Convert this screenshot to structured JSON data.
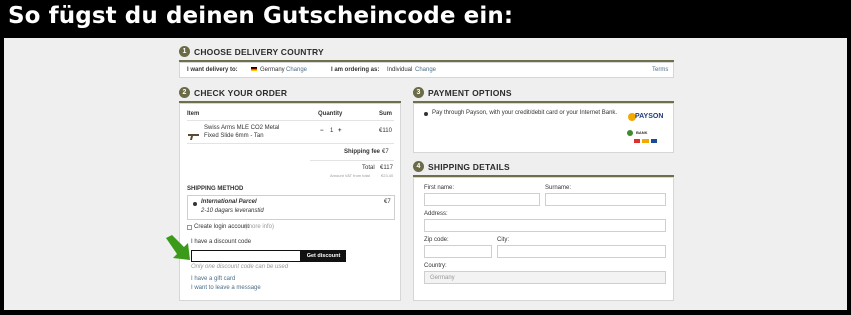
{
  "banner": {
    "title": "So fügst du deinen Gutscheincode ein:"
  },
  "sections": {
    "delivery": {
      "num": "1",
      "title": "CHOOSE DELIVERY COUNTRY"
    },
    "order": {
      "num": "2",
      "title": "CHECK YOUR ORDER"
    },
    "payment": {
      "num": "3",
      "title": "PAYMENT OPTIONS"
    },
    "shipping_details": {
      "num": "4",
      "title": "SHIPPING DETAILS"
    }
  },
  "delivery": {
    "deliver_label": "I want delivery to:",
    "country": "Germany",
    "change_label": "Change",
    "ordering_label": "I am ordering as:",
    "ordering_value": "Individual",
    "change2_label": "Change",
    "terms_label": "Terms"
  },
  "order": {
    "col_item": "Item",
    "col_qty": "Quantity",
    "col_sum": "Sum",
    "item": {
      "name_line1": "Swiss Arms MLE CO2 Metal",
      "name_line2": "Fixed Slide 6mm - Tan",
      "qty": "1",
      "minus": "−",
      "plus": "+",
      "sum": "€110"
    },
    "shipping_fee_label": "Shipping fee",
    "shipping_fee_value": "€7",
    "total_label": "Total",
    "total_value": "€117",
    "vat_note_label": "Amount VAT from total",
    "vat_note_value": "€23.40",
    "shipping_method_title": "SHIPPING METHOD",
    "method_name": "International Parcel",
    "method_days": "2-10 dagars leveranstid",
    "method_price": "€7",
    "create_account_label": "Create login account",
    "more_info_label": "(more info)",
    "discount_label": "I have a discount code",
    "get_discount_label": "Get discount",
    "discount_hint": "Only one discount code can be used",
    "gift_card_label": "I have a gift card",
    "message_label": "I want to leave a message"
  },
  "payment": {
    "option_text": "Pay through Payson, with your credit/debit card or your Internet Bank.",
    "logo_text": "PAYSON",
    "bank_text": "BANK"
  },
  "shipping_form": {
    "first_name_label": "First name:",
    "surname_label": "Surname:",
    "address_label": "Address:",
    "zip_label": "Zip code:",
    "city_label": "City:",
    "country_label": "Country:",
    "country_value": "Germany"
  },
  "colors": {
    "accent_olive": "#6b6b48",
    "banner_bg": "#000000",
    "arrow_green": "#3b9a1a",
    "link_blue": "#4a6f8a"
  }
}
